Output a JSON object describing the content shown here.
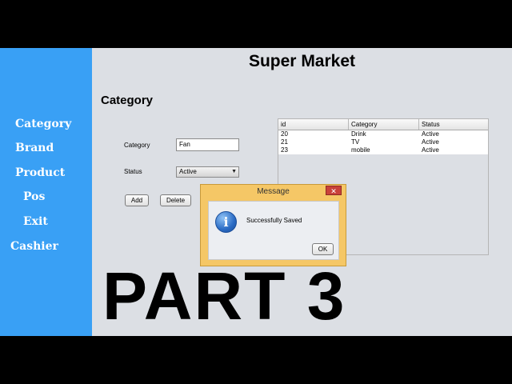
{
  "app": {
    "title": "Super Market"
  },
  "sidebar": {
    "items": [
      {
        "label": "Category"
      },
      {
        "label": "Brand"
      },
      {
        "label": "Product"
      },
      {
        "label": "Pos"
      },
      {
        "label": "Exit"
      },
      {
        "label": "Cashier"
      }
    ]
  },
  "form": {
    "section_title": "Category",
    "category_label": "Category",
    "category_value": "Fan",
    "status_label": "Status",
    "status_value": "Active",
    "add_label": "Add",
    "delete_label": "Delete"
  },
  "table": {
    "columns": [
      "id",
      "Category",
      "Status"
    ],
    "rows": [
      [
        "20",
        "Drink",
        "Active"
      ],
      [
        "21",
        "TV",
        "Active"
      ],
      [
        "23",
        "mobile",
        "Active"
      ]
    ]
  },
  "dialog": {
    "title": "Message",
    "close_glyph": "✕",
    "message": "Successfully Saved",
    "ok_label": "OK",
    "icon": "info-icon"
  },
  "overlay": {
    "text": "PART 3"
  }
}
